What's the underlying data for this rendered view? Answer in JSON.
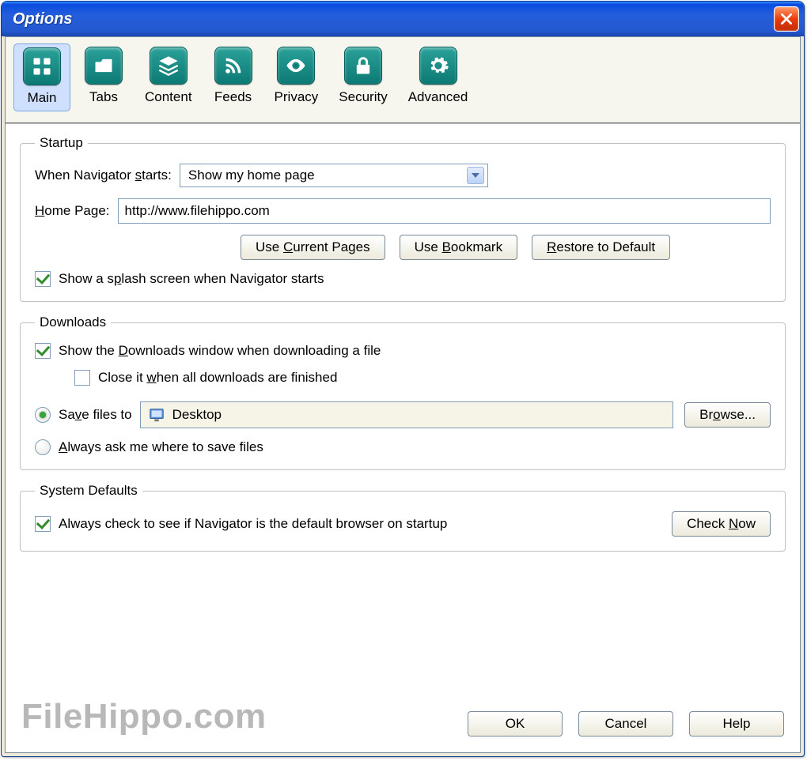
{
  "window": {
    "title": "Options"
  },
  "tabs": {
    "main": "Main",
    "tabs": "Tabs",
    "content": "Content",
    "feeds": "Feeds",
    "privacy": "Privacy",
    "security": "Security",
    "advanced": "Advanced"
  },
  "startup": {
    "legend": "Startup",
    "when_label_pre": "When Navigator ",
    "when_label_u": "s",
    "when_label_post": "tarts:",
    "when_value": "Show my home page",
    "home_label_u": "H",
    "home_label_post": "ome Page:",
    "home_value": "http://www.filehippo.com",
    "btn_current_pre": "Use ",
    "btn_current_u": "C",
    "btn_current_post": "urrent Pages",
    "btn_bookmark_pre": "Use ",
    "btn_bookmark_u": "B",
    "btn_bookmark_post": "ookmark",
    "btn_restore_u": "R",
    "btn_restore_post": "estore to Default",
    "splash_pre": "Show a s",
    "splash_u": "p",
    "splash_post": "lash screen when Navigator starts"
  },
  "downloads": {
    "legend": "Downloads",
    "show_pre": "Show the ",
    "show_u": "D",
    "show_post": "ownloads window when downloading a file",
    "close_pre": "Close it ",
    "close_u": "w",
    "close_post": "hen all downloads are finished",
    "save_pre": "Sa",
    "save_u": "v",
    "save_post": "e files to",
    "save_location": "Desktop",
    "browse_pre": "Br",
    "browse_u": "o",
    "browse_post": "wse...",
    "ask_u": "A",
    "ask_post": "lways ask me where to save files"
  },
  "system": {
    "legend": "System Defaults",
    "check_label": "Always check to see if Navigator is the default browser on startup",
    "btn_pre": "Check ",
    "btn_u": "N",
    "btn_post": "ow"
  },
  "footer": {
    "watermark": "FileHippo.com",
    "ok": "OK",
    "cancel": "Cancel",
    "help": "Help"
  }
}
